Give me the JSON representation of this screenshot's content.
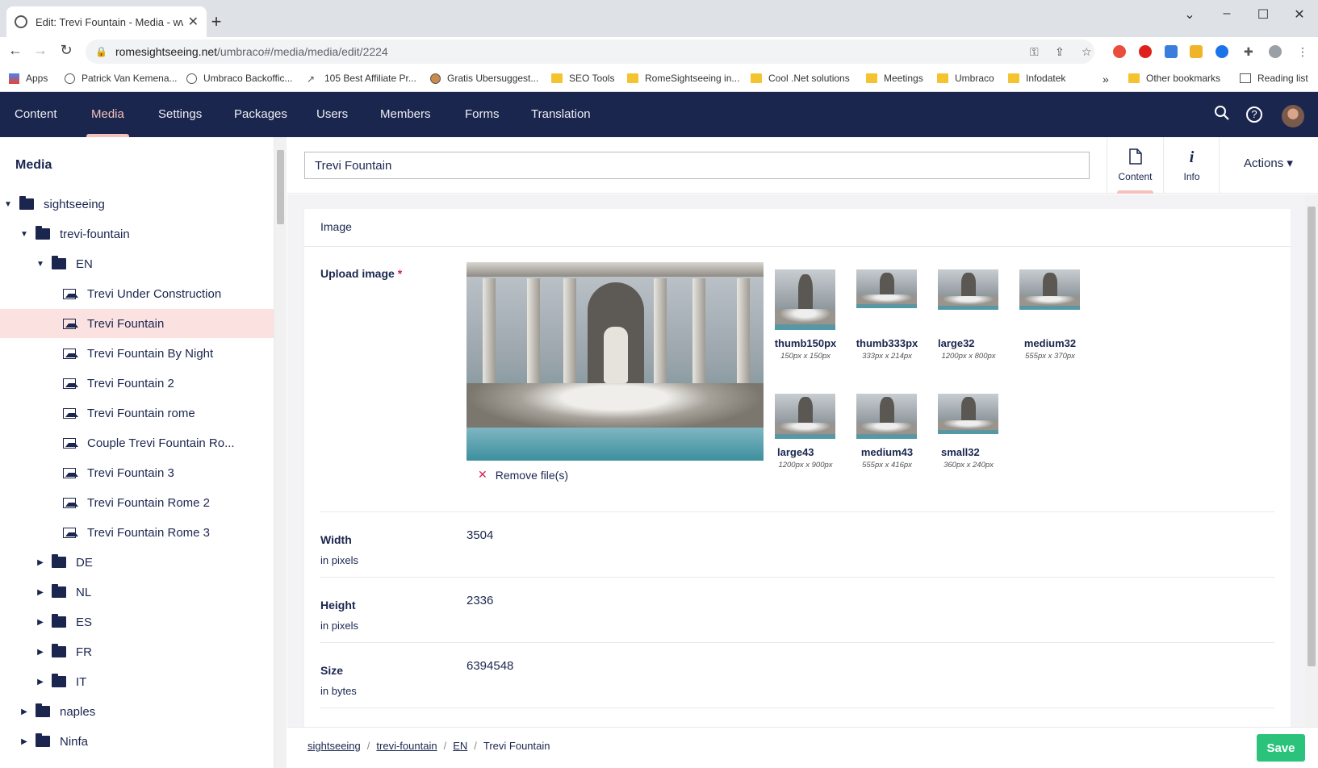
{
  "browser": {
    "tab_title": "Edit: Trevi Fountain - Media - ww",
    "url_host": "romesightseeing.net",
    "url_path": "/umbraco#/media/media/edit/2224",
    "bookmarks": [
      "Apps",
      "Patrick Van Kemena...",
      "Umbraco Backoffic...",
      "105 Best Affiliate Pr...",
      "Gratis Ubersuggest...",
      "SEO Tools",
      "RomeSightseeing in...",
      "Cool .Net solutions",
      "Meetings",
      "Umbraco",
      "Infodatek",
      "Other bookmarks",
      "Reading list"
    ],
    "overflow_label": "»"
  },
  "header": {
    "sections": [
      "Content",
      "Media",
      "Settings",
      "Packages",
      "Users",
      "Members",
      "Forms",
      "Translation"
    ],
    "active_section": "Media"
  },
  "tree": {
    "title": "Media",
    "nodes": [
      {
        "label": "sightseeing",
        "type": "folder",
        "level": 0,
        "expanded": true
      },
      {
        "label": "trevi-fountain",
        "type": "folder",
        "level": 1,
        "expanded": true
      },
      {
        "label": "EN",
        "type": "folder",
        "level": 2,
        "expanded": true
      },
      {
        "label": "Trevi Under Construction",
        "type": "image",
        "level": 3
      },
      {
        "label": "Trevi Fountain",
        "type": "image",
        "level": 3,
        "selected": true
      },
      {
        "label": "Trevi Fountain By Night",
        "type": "image",
        "level": 3
      },
      {
        "label": "Trevi Fountain 2",
        "type": "image",
        "level": 3
      },
      {
        "label": "Trevi Fountain rome",
        "type": "image",
        "level": 3
      },
      {
        "label": "Couple Trevi Fountain Ro...",
        "type": "image",
        "level": 3
      },
      {
        "label": "Trevi Fountain 3",
        "type": "image",
        "level": 3
      },
      {
        "label": "Trevi Fountain Rome 2",
        "type": "image",
        "level": 3
      },
      {
        "label": "Trevi Fountain Rome 3",
        "type": "image",
        "level": 3
      },
      {
        "label": "DE",
        "type": "folder",
        "level": 2,
        "expanded": false
      },
      {
        "label": "NL",
        "type": "folder",
        "level": 2,
        "expanded": false
      },
      {
        "label": "ES",
        "type": "folder",
        "level": 2,
        "expanded": false
      },
      {
        "label": "FR",
        "type": "folder",
        "level": 2,
        "expanded": false
      },
      {
        "label": "IT",
        "type": "folder",
        "level": 2,
        "expanded": false
      },
      {
        "label": "naples",
        "type": "folder",
        "level": 1,
        "expanded": false
      },
      {
        "label": "Ninfa",
        "type": "folder",
        "level": 1,
        "expanded": false
      }
    ]
  },
  "editor": {
    "name_value": "Trevi Fountain",
    "tabs": [
      {
        "label": "Content",
        "icon": "document-icon"
      },
      {
        "label": "Info",
        "icon": "info-icon"
      }
    ],
    "actions_label": "Actions ▾",
    "group_title": "Image",
    "upload": {
      "label": "Upload image",
      "required_mark": "*",
      "remove_label": "Remove file(s)",
      "crops": [
        {
          "name": "thumb150px",
          "size": "150px x 150px"
        },
        {
          "name": "thumb333px",
          "size": "333px x 214px"
        },
        {
          "name": "large32",
          "size": "1200px x 800px"
        },
        {
          "name": "medium32",
          "size": "555px x 370px"
        },
        {
          "name": "large43",
          "size": "1200px x 900px"
        },
        {
          "name": "medium43",
          "size": "555px x 416px"
        },
        {
          "name": "small32",
          "size": "360px x 240px"
        }
      ]
    },
    "properties": [
      {
        "label": "Width",
        "description": "in pixels",
        "value": "3504"
      },
      {
        "label": "Height",
        "description": "in pixels",
        "value": "2336"
      },
      {
        "label": "Size",
        "description": "in bytes",
        "value": "6394548"
      }
    ]
  },
  "footer": {
    "breadcrumb": [
      "sightseeing",
      "trevi-fountain",
      "EN",
      "Trevi Fountain"
    ],
    "save_label": "Save"
  },
  "colors": {
    "header_bg": "#1b264f",
    "accent": "#f5c1bc",
    "save": "#2bc37c",
    "selected_row": "#fbe1e0"
  }
}
